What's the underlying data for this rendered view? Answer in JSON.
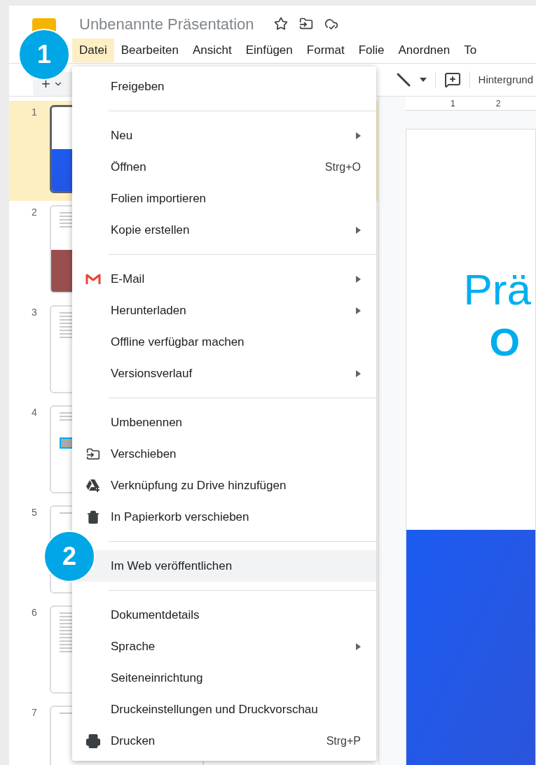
{
  "document": {
    "title": "Unbenannte Präsentation"
  },
  "menubar": [
    {
      "label": "Datei",
      "selected": true
    },
    {
      "label": "Bearbeiten",
      "selected": false
    },
    {
      "label": "Ansicht",
      "selected": false
    },
    {
      "label": "Einfügen",
      "selected": false
    },
    {
      "label": "Format",
      "selected": false
    },
    {
      "label": "Folie",
      "selected": false
    },
    {
      "label": "Anordnen",
      "selected": false
    },
    {
      "label": "To",
      "selected": false
    }
  ],
  "toolbar": {
    "add_label": "+",
    "background_button": "Hintergrund"
  },
  "ruler": [
    "1",
    "2"
  ],
  "slides": [
    {
      "number": "1",
      "selected": true,
      "kind": "title"
    },
    {
      "number": "2",
      "selected": false,
      "kind": "photo"
    },
    {
      "number": "3",
      "selected": false,
      "kind": "text"
    },
    {
      "number": "4",
      "selected": false,
      "kind": "figure"
    },
    {
      "number": "5",
      "selected": false,
      "kind": "heading"
    },
    {
      "number": "6",
      "selected": false,
      "kind": "list"
    },
    {
      "number": "7",
      "selected": false,
      "kind": "heading"
    }
  ],
  "current_slide": {
    "title_line_1": "Prä",
    "title_line_2": "O"
  },
  "file_menu": [
    {
      "kind": "item",
      "label": "Freigeben",
      "submenu": false,
      "highlighted": false
    },
    {
      "kind": "separator"
    },
    {
      "kind": "item",
      "label": "Neu",
      "submenu": true,
      "highlighted": false
    },
    {
      "kind": "item",
      "label": "Öffnen",
      "shortcut": "Strg+O",
      "submenu": false,
      "highlighted": false
    },
    {
      "kind": "item",
      "label": "Folien importieren",
      "submenu": false,
      "highlighted": false
    },
    {
      "kind": "item",
      "label": "Kopie erstellen",
      "submenu": true,
      "highlighted": false
    },
    {
      "kind": "separator"
    },
    {
      "kind": "mail",
      "label": "E-Mail",
      "submenu": true,
      "highlighted": false
    },
    {
      "kind": "item",
      "label": "Herunterladen",
      "submenu": true,
      "highlighted": false
    },
    {
      "kind": "item",
      "label": "Offline verfügbar machen",
      "submenu": false,
      "highlighted": false
    },
    {
      "kind": "item",
      "label": "Versionsverlauf",
      "submenu": true,
      "highlighted": false
    },
    {
      "kind": "separator"
    },
    {
      "kind": "item",
      "label": "Umbenennen",
      "submenu": false,
      "highlighted": false
    },
    {
      "kind": "move",
      "label": "Verschieben",
      "submenu": false,
      "highlighted": false
    },
    {
      "kind": "drive",
      "label": "Verknüpfung zu Drive hinzufügen",
      "submenu": false,
      "highlighted": false
    },
    {
      "kind": "trash",
      "label": "In Papierkorb verschieben",
      "submenu": false,
      "highlighted": false
    },
    {
      "kind": "separator"
    },
    {
      "kind": "item",
      "label": "Im Web veröffentlichen",
      "submenu": false,
      "highlighted": true
    },
    {
      "kind": "separator"
    },
    {
      "kind": "item",
      "label": "Dokumentdetails",
      "submenu": false,
      "highlighted": false
    },
    {
      "kind": "item",
      "label": "Sprache",
      "submenu": true,
      "highlighted": false
    },
    {
      "kind": "item",
      "label": "Seiteneinrichtung",
      "submenu": false,
      "highlighted": false
    },
    {
      "kind": "item",
      "label": "Druckeinstellungen und Druckvorschau",
      "submenu": false,
      "highlighted": false
    },
    {
      "kind": "print",
      "label": "Drucken",
      "shortcut": "Strg+P",
      "submenu": false,
      "highlighted": false
    }
  ],
  "step_badges": [
    "1",
    "2"
  ]
}
